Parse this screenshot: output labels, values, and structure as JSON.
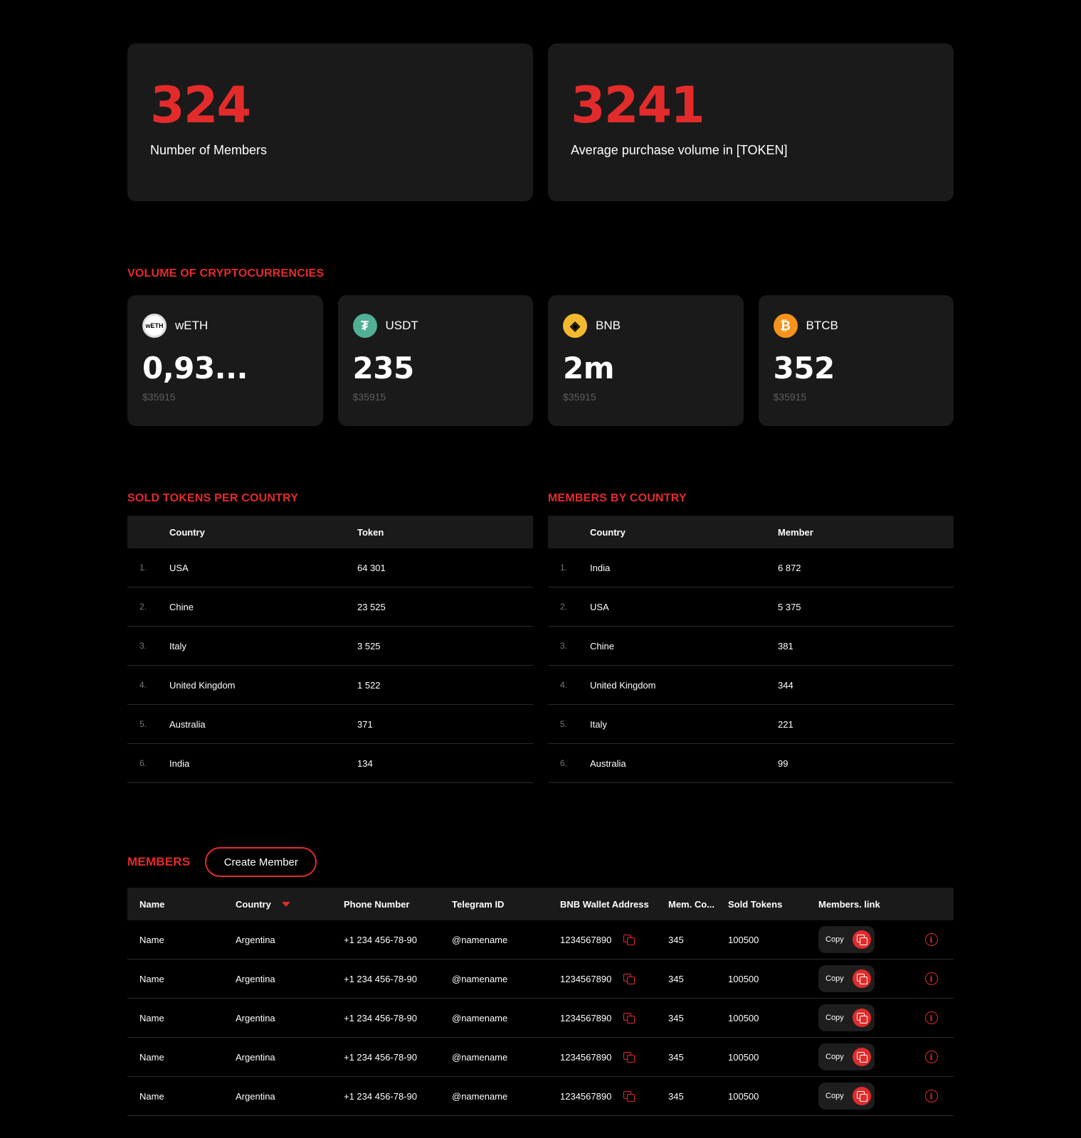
{
  "stats": [
    {
      "value": "324",
      "label": "Number of Members"
    },
    {
      "value": "3241",
      "label": "Average purchase volume in [TOKEN]"
    }
  ],
  "crypto": {
    "title": "VOLUME OF CRYPTOCURRENCIES",
    "cards": [
      {
        "name": "wETH",
        "amount": "0,93...",
        "usd": "$35915",
        "icon": "weth-icon",
        "icon_glyph": "wETH"
      },
      {
        "name": "USDT",
        "amount": "235",
        "usd": "$35915",
        "icon": "usdt-icon",
        "icon_glyph": "₮"
      },
      {
        "name": "BNB",
        "amount": "2m",
        "usd": "$35915",
        "icon": "bnb-icon",
        "icon_glyph": "◈"
      },
      {
        "name": "BTCB",
        "amount": "352",
        "usd": "$35915",
        "icon": "btcb-icon",
        "icon_glyph": "₿"
      }
    ]
  },
  "sold_tokens": {
    "title": "SOLD TOKENS PER COUNTRY",
    "headers": {
      "country": "Country",
      "value": "Token"
    },
    "rows": [
      {
        "idx": "1.",
        "country": "USA",
        "value": "64 301"
      },
      {
        "idx": "2.",
        "country": "Chine",
        "value": "23 525"
      },
      {
        "idx": "3.",
        "country": "Italy",
        "value": "3 525"
      },
      {
        "idx": "4.",
        "country": "United Kingdom",
        "value": "1 522"
      },
      {
        "idx": "5.",
        "country": "Australia",
        "value": "371"
      },
      {
        "idx": "6.",
        "country": "India",
        "value": "134"
      }
    ]
  },
  "members_by_country": {
    "title": "MEMBERS BY COUNTRY",
    "headers": {
      "country": "Country",
      "value": "Member"
    },
    "rows": [
      {
        "idx": "1.",
        "country": "India",
        "value": "6 872"
      },
      {
        "idx": "2.",
        "country": "USA",
        "value": "5 375"
      },
      {
        "idx": "3.",
        "country": "Chine",
        "value": "381"
      },
      {
        "idx": "4.",
        "country": "United Kingdom",
        "value": "344"
      },
      {
        "idx": "5.",
        "country": "Italy",
        "value": "221"
      },
      {
        "idx": "6.",
        "country": "Australia",
        "value": "99"
      }
    ]
  },
  "members": {
    "title": "MEMBERS",
    "create_label": "Create Member",
    "headers": {
      "name": "Name",
      "country": "Country",
      "phone": "Phone Number",
      "telegram": "Telegram ID",
      "wallet": "BNB Wallet Address",
      "mem_co": "Mem. Co...",
      "sold": "Sold Tokens",
      "link": "Members. link"
    },
    "copy_label": "Copy",
    "rows": [
      {
        "name": "Name",
        "country": "Argentina",
        "phone": "+1 234 456-78-90",
        "telegram": "@namename",
        "wallet": "1234567890",
        "mem_co": "345",
        "sold": "100500"
      },
      {
        "name": "Name",
        "country": "Argentina",
        "phone": "+1 234 456-78-90",
        "telegram": "@namename",
        "wallet": "1234567890",
        "mem_co": "345",
        "sold": "100500"
      },
      {
        "name": "Name",
        "country": "Argentina",
        "phone": "+1 234 456-78-90",
        "telegram": "@namename",
        "wallet": "1234567890",
        "mem_co": "345",
        "sold": "100500"
      },
      {
        "name": "Name",
        "country": "Argentina",
        "phone": "+1 234 456-78-90",
        "telegram": "@namename",
        "wallet": "1234567890",
        "mem_co": "345",
        "sold": "100500"
      },
      {
        "name": "Name",
        "country": "Argentina",
        "phone": "+1 234 456-78-90",
        "telegram": "@namename",
        "wallet": "1234567890",
        "mem_co": "345",
        "sold": "100500"
      }
    ]
  },
  "colors": {
    "accent": "#e32b2b",
    "card": "#1a1a1a",
    "background": "#000000"
  }
}
